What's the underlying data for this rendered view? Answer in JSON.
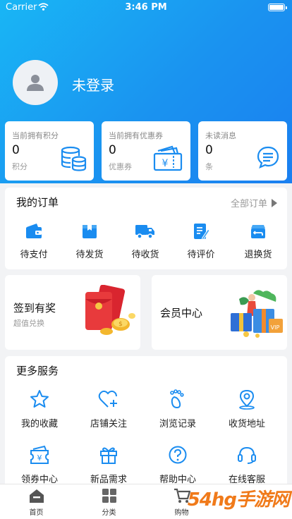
{
  "status_bar": {
    "carrier": "Carrier",
    "time": "3:46 PM"
  },
  "profile": {
    "username": "未登录"
  },
  "stats": [
    {
      "label": "当前拥有积分",
      "value": "0",
      "unit": "积分",
      "icon": "database-icon"
    },
    {
      "label": "当前拥有优惠券",
      "value": "0",
      "unit": "优惠券",
      "icon": "coupon-icon"
    },
    {
      "label": "未读消息",
      "value": "0",
      "unit": "条",
      "icon": "message-icon"
    }
  ],
  "orders": {
    "title": "我的订单",
    "all_label": "全部订单",
    "items": [
      {
        "label": "待支付",
        "icon": "wallet-icon"
      },
      {
        "label": "待发货",
        "icon": "box-icon"
      },
      {
        "label": "待收货",
        "icon": "truck-icon"
      },
      {
        "label": "待评价",
        "icon": "edit-icon"
      },
      {
        "label": "退换货",
        "icon": "return-icon"
      }
    ]
  },
  "promos": {
    "signin": {
      "title": "签到有奖",
      "subtitle": "超值兑换"
    },
    "member": {
      "title": "会员中心"
    }
  },
  "services": {
    "title": "更多服务",
    "items": [
      {
        "label": "我的收藏",
        "icon": "star-icon"
      },
      {
        "label": "店铺关注",
        "icon": "heart-plus-icon"
      },
      {
        "label": "浏览记录",
        "icon": "footprint-icon"
      },
      {
        "label": "收货地址",
        "icon": "location-icon"
      },
      {
        "label": "领券中心",
        "icon": "ticket-icon"
      },
      {
        "label": "新品需求",
        "icon": "gift-icon"
      },
      {
        "label": "帮助中心",
        "icon": "help-icon"
      },
      {
        "label": "在线客服",
        "icon": "headset-icon"
      }
    ]
  },
  "tabbar": [
    {
      "label": "首页",
      "icon": "home-icon"
    },
    {
      "label": "分类",
      "icon": "category-icon"
    },
    {
      "label": "购物",
      "icon": "cart-icon"
    }
  ],
  "watermark": "54hg手游网",
  "colors": {
    "primary": "#1a8cf0",
    "header_start": "#19b6f5",
    "header_end": "#1a7ff0"
  }
}
